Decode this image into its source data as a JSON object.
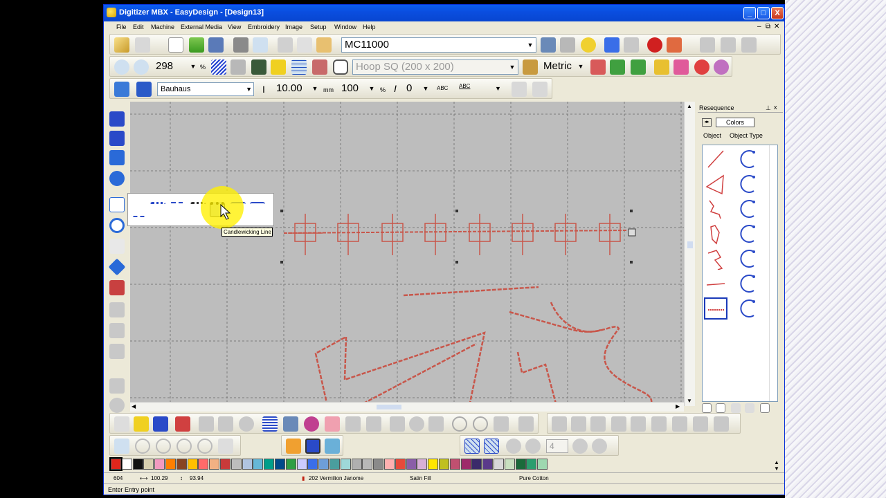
{
  "window": {
    "title": "Digitizer MBX - EasyDesign - [Design13]",
    "controls": [
      "_",
      "□",
      "X"
    ]
  },
  "menu": [
    "File",
    "Edit",
    "Machine",
    "External Media",
    "View",
    "Embroidery",
    "Image",
    "Setup",
    "Window",
    "Help"
  ],
  "toolbar1": {
    "machine_model": "MC11000"
  },
  "toolbar2": {
    "zoom_value": "298",
    "zoom_unit": "%",
    "hoop": "Hoop SQ (200 x 200)",
    "units": "Metric"
  },
  "toolbar3": {
    "font": "Bauhaus",
    "height_value": "10.00",
    "height_unit": "mm",
    "width_value": "100",
    "width_unit": "%",
    "angle_value": "0",
    "abc_label_1": "ABC",
    "abc_label_2": "ABC"
  },
  "flyout": {
    "tooltip": "Candlewicking Line"
  },
  "resequence": {
    "title": "Resequence",
    "colors_button": "Colors",
    "col_object": "Object",
    "col_type": "Object Type",
    "pin": "⊥",
    "close": "x"
  },
  "bottom_toolbar": {
    "spin_value": "4"
  },
  "palette": [
    "#e0261c",
    "#ffffff",
    "#111111",
    "#d8d0b0",
    "#f29ac0",
    "#ff7f00",
    "#884422",
    "#ffbf00",
    "#ff6a6a",
    "#f2b183",
    "#c83a3a",
    "#bdbdbd",
    "#b0c4e0",
    "#66b8d8",
    "#009e8a",
    "#004a8a",
    "#2f9e44",
    "#ccccff",
    "#3a6ee8",
    "#6e9ed8",
    "#4a9e9e",
    "#9ed8d8",
    "#b0b0b0",
    "#b8b8b8",
    "#8a8a8a",
    "#ffb0b0",
    "#e64a3a",
    "#8a5ea8",
    "#d8b0d8",
    "#ffe600",
    "#c0c020",
    "#c05070",
    "#9e2a6a",
    "#3a2a6a",
    "#5a3a8a",
    "#d8d8d8",
    "#c8e0c0",
    "#1a6a3a",
    "#2a9e6e",
    "#9ed8b0"
  ],
  "status": {
    "stitch_count": "604",
    "width": "100.29",
    "height": "93.94",
    "thread": "202 Vermilion Janome",
    "stitch_type": "Satin Fill",
    "fabric": "Pure Cotton"
  },
  "prompt": "Enter Entry point"
}
